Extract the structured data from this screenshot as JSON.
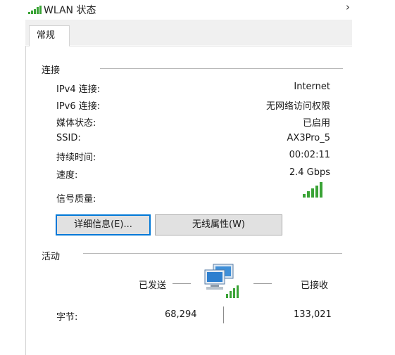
{
  "window": {
    "title": "WLAN 状态",
    "collapse_glyph": "›"
  },
  "tabs": [
    {
      "label": "常规"
    }
  ],
  "connection": {
    "section_title": "连接",
    "rows": [
      {
        "label": "IPv4 连接:",
        "value": "Internet"
      },
      {
        "label": "IPv6 连接:",
        "value": "无网络访问权限"
      },
      {
        "label": "媒体状态:",
        "value": "已启用"
      },
      {
        "label": "SSID:",
        "value": "AX3Pro_5"
      },
      {
        "label": "持续时间:",
        "value": "00:02:11"
      },
      {
        "label": "速度:",
        "value": "2.4 Gbps"
      }
    ],
    "signal_label": "信号质量:",
    "signal_bars": 5,
    "signal_color": "#3aa336"
  },
  "buttons": {
    "details": "详细信息(E)...",
    "wireless_properties": "无线属性(W)"
  },
  "activity": {
    "section_title": "活动",
    "sent_label": "已发送",
    "received_label": "已接收",
    "bytes_label": "字节:",
    "bytes_sent": "68,294",
    "bytes_received": "133,021"
  }
}
